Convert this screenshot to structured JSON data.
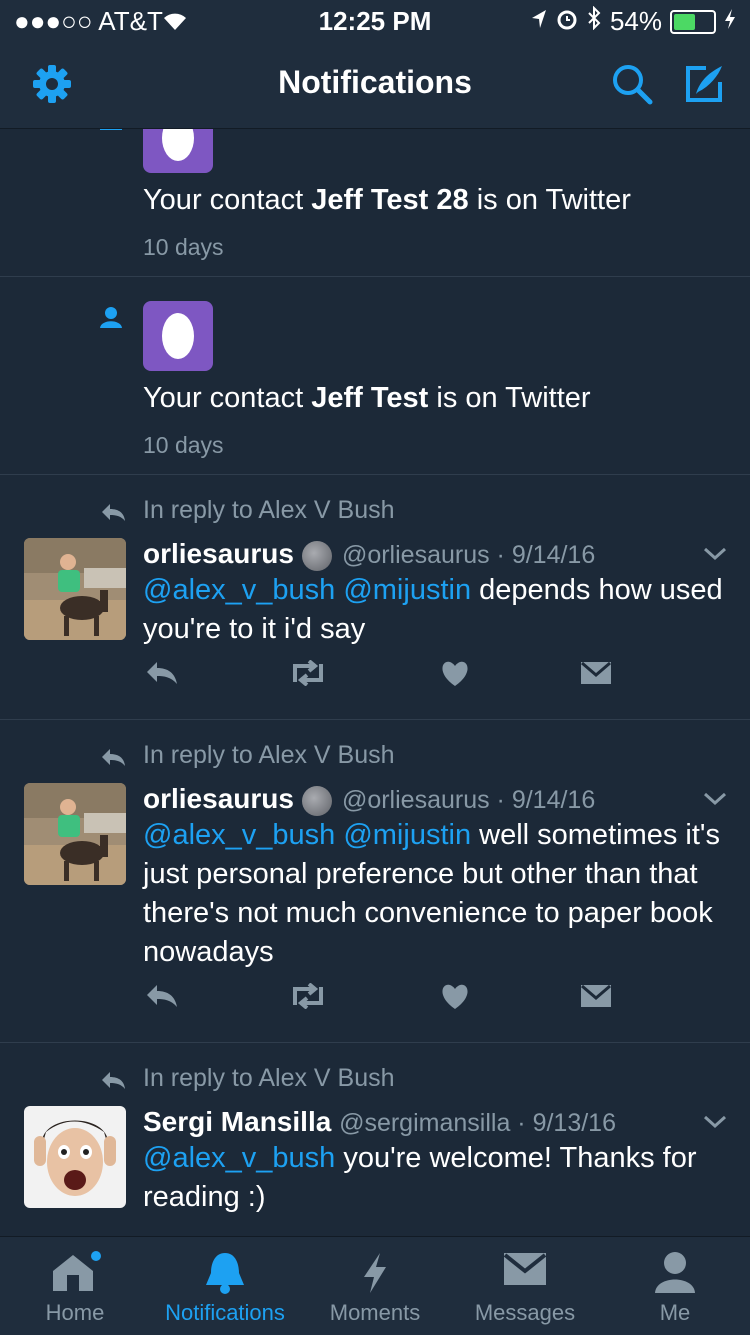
{
  "status_bar": {
    "carrier": "●●●○○ AT&T",
    "time": "12:25 PM",
    "battery_pct": "54%",
    "battery_level": 0.54
  },
  "nav": {
    "title": "Notifications",
    "left_icon": "gear-icon",
    "right_icons": [
      "search-icon",
      "compose-icon"
    ]
  },
  "contacts": [
    {
      "prefix": "Your contact ",
      "name": "Jeff Test 28",
      "suffix": " is on Twitter",
      "time": "10 days"
    },
    {
      "prefix": "Your contact ",
      "name": "Jeff Test",
      "suffix": " is on Twitter",
      "time": "10 days"
    }
  ],
  "tweets": [
    {
      "reply_to": "In reply to Alex V Bush",
      "name": "orliesaurus",
      "handle": "@orliesaurus",
      "date": "9/14/16",
      "mentions": "@alex_v_bush @mijustin",
      "text": " depends how used you're to it i'd say"
    },
    {
      "reply_to": "In reply to Alex V Bush",
      "name": "orliesaurus",
      "handle": "@orliesaurus",
      "date": "9/14/16",
      "mentions": "@alex_v_bush @mijustin",
      "text": " well sometimes it's just personal preference but other than that there's not much convenience to paper book nowadays"
    },
    {
      "reply_to": "In reply to Alex V Bush",
      "name": "Sergi Mansilla",
      "handle": "@sergimansilla",
      "date": "9/13/16",
      "mentions": "@alex_v_bush",
      "text": " you're welcome! Thanks for reading :)"
    }
  ],
  "tabs": [
    {
      "label": "Home",
      "icon": "home-icon",
      "active": false
    },
    {
      "label": "Notifications",
      "icon": "bell-icon",
      "active": true
    },
    {
      "label": "Moments",
      "icon": "lightning-icon",
      "active": false
    },
    {
      "label": "Messages",
      "icon": "envelope-icon",
      "active": false
    },
    {
      "label": "Me",
      "icon": "person-icon",
      "active": false
    }
  ],
  "colors": {
    "background": "#1c2938",
    "bar": "#1f2d3d",
    "accent": "#1da1f2",
    "muted": "#8899a6",
    "egg": "#7e57c2"
  }
}
